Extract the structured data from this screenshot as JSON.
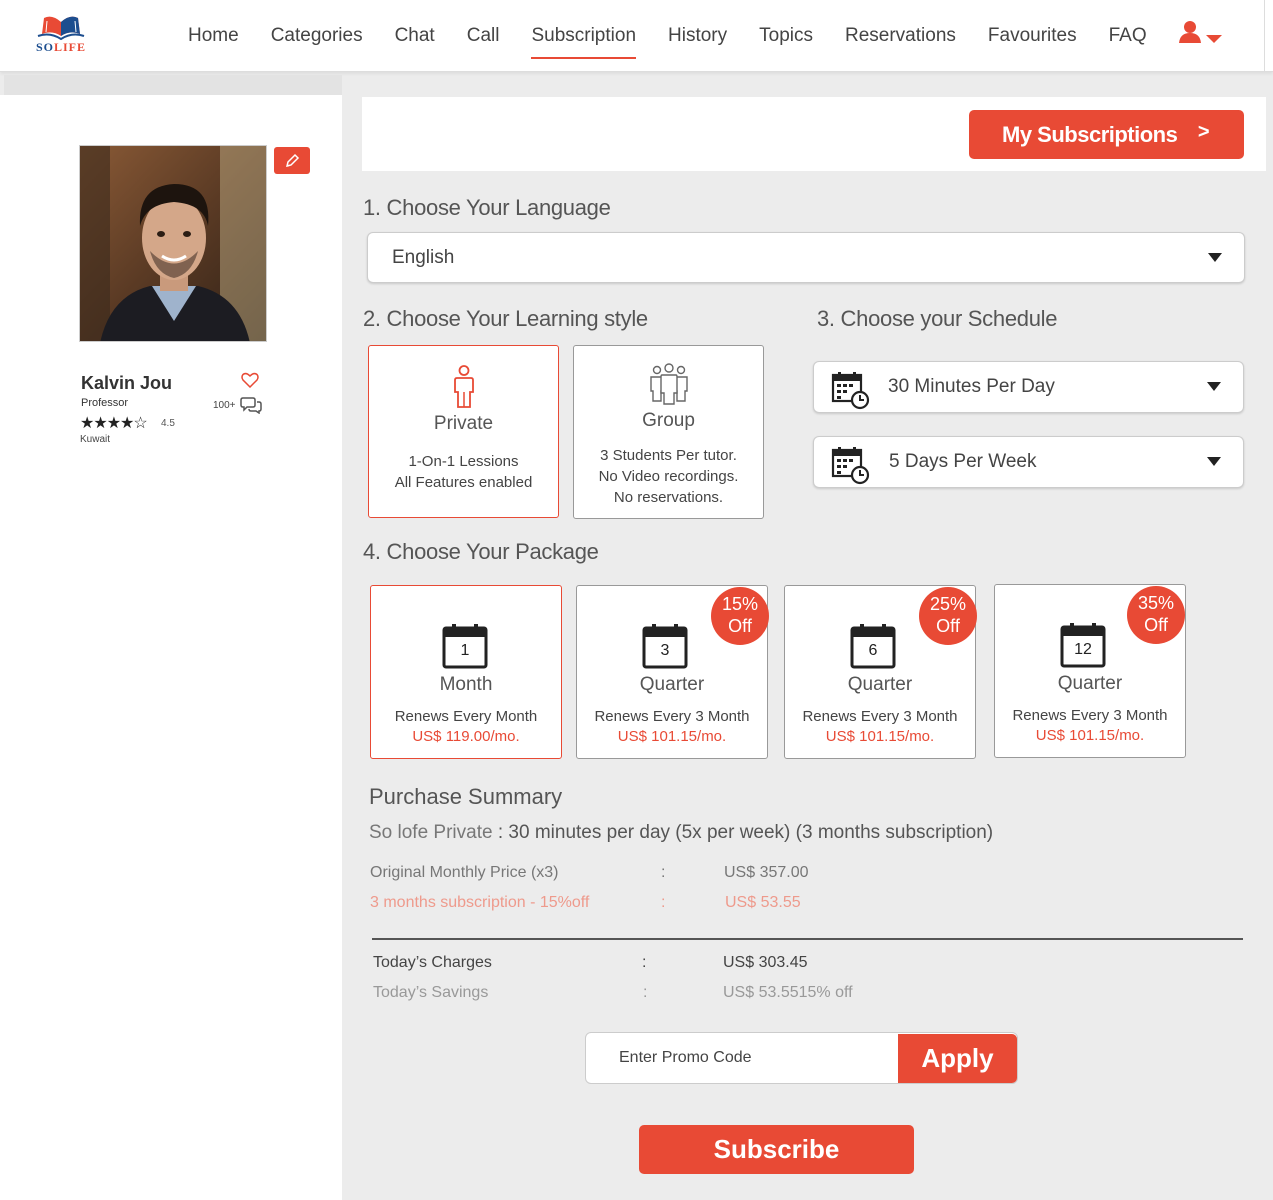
{
  "brand": {
    "logo_text_a": "SO",
    "logo_text_b": "LIFE"
  },
  "nav": {
    "items": [
      {
        "label": "Home"
      },
      {
        "label": "Categories"
      },
      {
        "label": "Chat"
      },
      {
        "label": "Call"
      },
      {
        "label": "Subscription",
        "active": true
      },
      {
        "label": "History"
      },
      {
        "label": "Topics"
      },
      {
        "label": "Reservations"
      },
      {
        "label": "Favourites"
      },
      {
        "label": "FAQ"
      }
    ]
  },
  "profile": {
    "name": "Kalvin Jou",
    "role": "Professor",
    "stars": "★★★★☆",
    "rating": "4.5",
    "location": "Kuwait",
    "reviews": "100+"
  },
  "header": {
    "my_subscriptions": "My Subscriptions",
    "chevron": ">"
  },
  "language": {
    "title": "1. Choose Your Language",
    "selected": "English"
  },
  "learning_style": {
    "title": "2. Choose Your Learning style",
    "options": [
      {
        "label": "Private",
        "desc1": "1-On-1 Lessions",
        "desc2": "All Features enabled",
        "selected": true
      },
      {
        "label": "Group",
        "desc1": "3 Students Per tutor.",
        "desc2": "No Video recordings.",
        "desc3": "No reservations."
      }
    ]
  },
  "schedule": {
    "title": "3. Choose your  Schedule",
    "duration": "30 Minutes Per Day",
    "frequency": "5 Days Per Week"
  },
  "package": {
    "title": "4. Choose Your  Package",
    "options": [
      {
        "number": "1",
        "label": "Month",
        "renew": "Renews Every Month",
        "price": "US$ 119.00/mo.",
        "selected": true
      },
      {
        "number": "3",
        "label": "Quarter",
        "renew": "Renews Every 3 Month",
        "price": "US$ 101.15/mo.",
        "badge_pct": "15%",
        "badge_off": "Off"
      },
      {
        "number": "6",
        "label": "Quarter",
        "renew": "Renews Every 3 Month",
        "price": "US$ 101.15/mo.",
        "badge_pct": "25%",
        "badge_off": "Off"
      },
      {
        "number": "12",
        "label": "Quarter",
        "renew": "Renews Every 3 Month",
        "price": "US$ 101.15/mo.",
        "badge_pct": "35%",
        "badge_off": "Off"
      }
    ]
  },
  "summary": {
    "title": "Purchase Summary",
    "plan_label": "So lofe Private",
    "plan_detail": " : 30 minutes per day (5x per week) (3 months subscription)",
    "original_label": "Original  Monthly Price (x3)",
    "original_value": "US$ 357.00",
    "discount_label": "3 months subscription - 15%off",
    "discount_value": "US$ 53.55",
    "charges_label": "Today’s Charges",
    "charges_value": "US$ 303.45",
    "savings_label": "Today’s Savings",
    "savings_value": "US$ 53.5515% off",
    "colon": ":"
  },
  "promo": {
    "placeholder": "Enter Promo Code",
    "apply": "Apply"
  },
  "subscribe": "Subscribe",
  "colors": {
    "accent": "#e84a35",
    "brand_blue": "#1d4e8f"
  }
}
